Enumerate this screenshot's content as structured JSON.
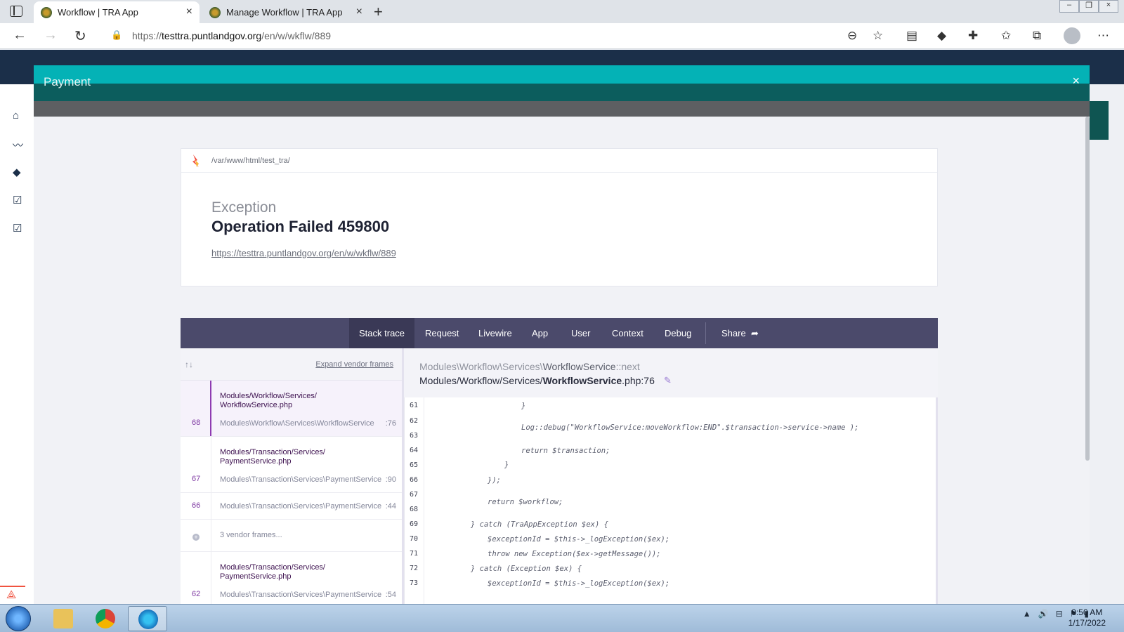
{
  "browser": {
    "tabs": [
      {
        "title": "Workflow | TRA App",
        "active": true
      },
      {
        "title": "Manage Workflow | TRA App",
        "active": false
      }
    ],
    "url_scheme": "https://",
    "url_host": "testtra.puntlandgov.org",
    "url_path": "/en/w/wkflw/889"
  },
  "modal": {
    "title": "Payment",
    "close_label": "×"
  },
  "error": {
    "path": "/var/www/html/test_tra/",
    "exception_class": "Exception",
    "message": "Operation Failed 459800",
    "url": "https://testtra.puntlandgov.org/en/w/wkflw/889"
  },
  "tabs": {
    "items": [
      "Stack trace",
      "Request",
      "Livewire",
      "App",
      "User",
      "Context",
      "Debug"
    ],
    "share": "Share"
  },
  "frames": {
    "expand_vendor": "Expand vendor frames",
    "items": [
      {
        "number": "68",
        "file_line1": "Modules/Workflow/Services/",
        "file_line2": "WorkflowService.php",
        "class": "Modules\\Workflow\\Services\\WorkflowService",
        "line": ":76"
      },
      {
        "number": "67",
        "file_line1": "Modules/Transaction/Services/",
        "file_line2": "PaymentService.php",
        "class": "Modules\\Transaction\\Services\\PaymentService",
        "line": ":90"
      },
      {
        "number": "66",
        "class": "Modules\\Transaction\\Services\\PaymentService",
        "line": ":44"
      },
      {
        "vendor_label": "3 vendor frames..."
      },
      {
        "number": "62",
        "file_line1": "Modules/Transaction/Services/",
        "file_line2": "PaymentService.php",
        "class": "Modules\\Transaction\\Services\\PaymentService",
        "line": ":54"
      }
    ]
  },
  "code": {
    "class_prefix": "Modules\\Workflow\\Services\\",
    "class_name": "WorkflowService",
    "method": "::next",
    "file_prefix": "Modules/Workflow/Services/",
    "file_name": "WorkflowService",
    "file_suffix": ".php:76",
    "lines": [
      {
        "n": "61",
        "text": "}"
      },
      {
        "n": "62",
        "text": "Log::debug(\"WorkflowService:moveWorkflow:END\".$transaction->service->name );"
      },
      {
        "n": "63",
        "text": ""
      },
      {
        "n": "64",
        "text": "return $transaction;"
      },
      {
        "n": "65",
        "text": "}"
      },
      {
        "n": "66",
        "text": "});"
      },
      {
        "n": "67",
        "text": "return $workflow;"
      },
      {
        "n": "68",
        "text": ""
      },
      {
        "n": "69",
        "text": "} catch (TraAppException $ex) {"
      },
      {
        "n": "70",
        "text": "$exceptionId = $this->_logException($ex);"
      },
      {
        "n": "71",
        "text": "throw new Exception($ex->getMessage());"
      },
      {
        "n": "72",
        "text": "} catch (Exception $ex) {"
      },
      {
        "n": "73",
        "text": "$exceptionId = $this->_logException($ex);"
      }
    ]
  },
  "taskbar": {
    "time": "9:50 AM",
    "date": "1/17/2022"
  },
  "colors": {
    "modal_header": "#04b2b6",
    "tabs_bar": "#4b4a6b",
    "frame_accent": "#8e3bb1"
  }
}
